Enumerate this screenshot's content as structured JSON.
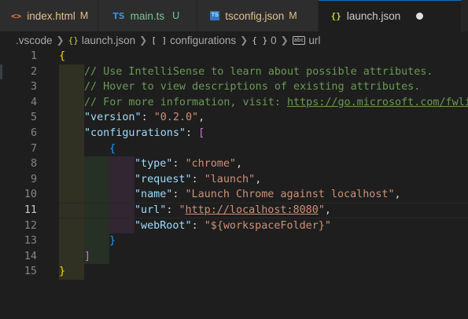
{
  "tabs": [
    {
      "icon": "html-file-icon",
      "icon_glyph": "<>",
      "name": "index.html",
      "badge": "M",
      "badge_color": "#e2c08d",
      "name_color": "#e2c08d",
      "active": false
    },
    {
      "icon": "typescript-file-icon",
      "icon_glyph": "TS",
      "name": "main.ts",
      "badge": "U",
      "badge_color": "#73c991",
      "name_color": "#73c991",
      "active": false
    },
    {
      "icon": "tsconfig-file-icon",
      "icon_glyph": "TS",
      "name": "tsconfig.json",
      "badge": "M",
      "badge_color": "#e2c08d",
      "name_color": "#e2c08d",
      "active": false
    },
    {
      "icon": "json-file-icon",
      "icon_glyph": "{}",
      "name": "launch.json",
      "badge": "",
      "active": true,
      "unsaved": true
    }
  ],
  "breadcrumb": {
    "folder": ".vscode",
    "file_icon": "{}",
    "file": "launch.json",
    "array_icon": "[ ]",
    "array": "configurations",
    "object_icon": "{ }",
    "index": "0",
    "string_icon": "abc",
    "key": "url"
  },
  "editor": {
    "current_line": 11,
    "line_numbers": [
      "1",
      "2",
      "3",
      "4",
      "5",
      "6",
      "7",
      "8",
      "9",
      "10",
      "11",
      "12",
      "13",
      "14",
      "15"
    ],
    "lines": {
      "l1_open": "{",
      "l2_comment": "// Use IntelliSense to learn about possible attributes.",
      "l3_comment": "// Hover to view descriptions of existing attributes.",
      "l4_comment": "// For more information, visit: ",
      "l4_link": "https://go.microsoft.com/fwli",
      "l5_key": "\"version\"",
      "l5_val": "\"0.2.0\"",
      "l6_key": "\"configurations\"",
      "l6_open": "[",
      "l7_open": "{",
      "l8_key": "\"type\"",
      "l8_val": "\"chrome\"",
      "l9_key": "\"request\"",
      "l9_val": "\"launch\"",
      "l10_key": "\"name\"",
      "l10_val": "\"Launch Chrome against localhost\"",
      "l11_key": "\"url\"",
      "l11_val_q1": "\"",
      "l11_val_link": "http://localhost:8080",
      "l11_val_q2": "\"",
      "l12_key": "\"webRoot\"",
      "l12_val": "\"${workspaceFolder}\"",
      "l13_close": "}",
      "l14_close": "]",
      "l15_close": "}",
      "colon": ": ",
      "comma": ","
    }
  }
}
